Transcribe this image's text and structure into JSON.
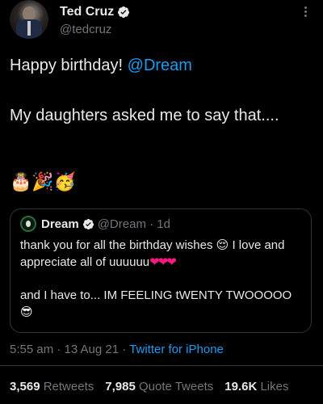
{
  "author": {
    "display_name": "Ted Cruz",
    "handle": "@tedcruz"
  },
  "tweet": {
    "line1_prefix": "Happy birthday! ",
    "line1_mention": "@Dream",
    "line2": "My daughters asked me to say that....",
    "emojis": "🎂🎉🥳"
  },
  "quote": {
    "display_name": "Dream",
    "meta": "@Dream · 1d",
    "text_part1": "thank you for all the birthday wishes ",
    "emoji1": "😌",
    "text_part2": " I love and appreciate all of uuuuuu",
    "hearts": "❤❤❤",
    "text_part3": "and I have to... IM FEELING tWENTY TWOOOOO",
    "emoji2": "😎"
  },
  "meta": {
    "time": "5:55 am · 13 Aug 21 · ",
    "source": "Twitter for iPhone"
  },
  "stats": {
    "retweets_count": "3,569",
    "retweets_label": "Retweets",
    "quotes_count": "7,985",
    "quotes_label": "Quote Tweets",
    "likes_count": "19.6K",
    "likes_label": "Likes"
  },
  "colors": {
    "accent": "#1d9bf0",
    "background": "#000000",
    "secondary_text": "#71767b",
    "heart": "#f91880"
  }
}
